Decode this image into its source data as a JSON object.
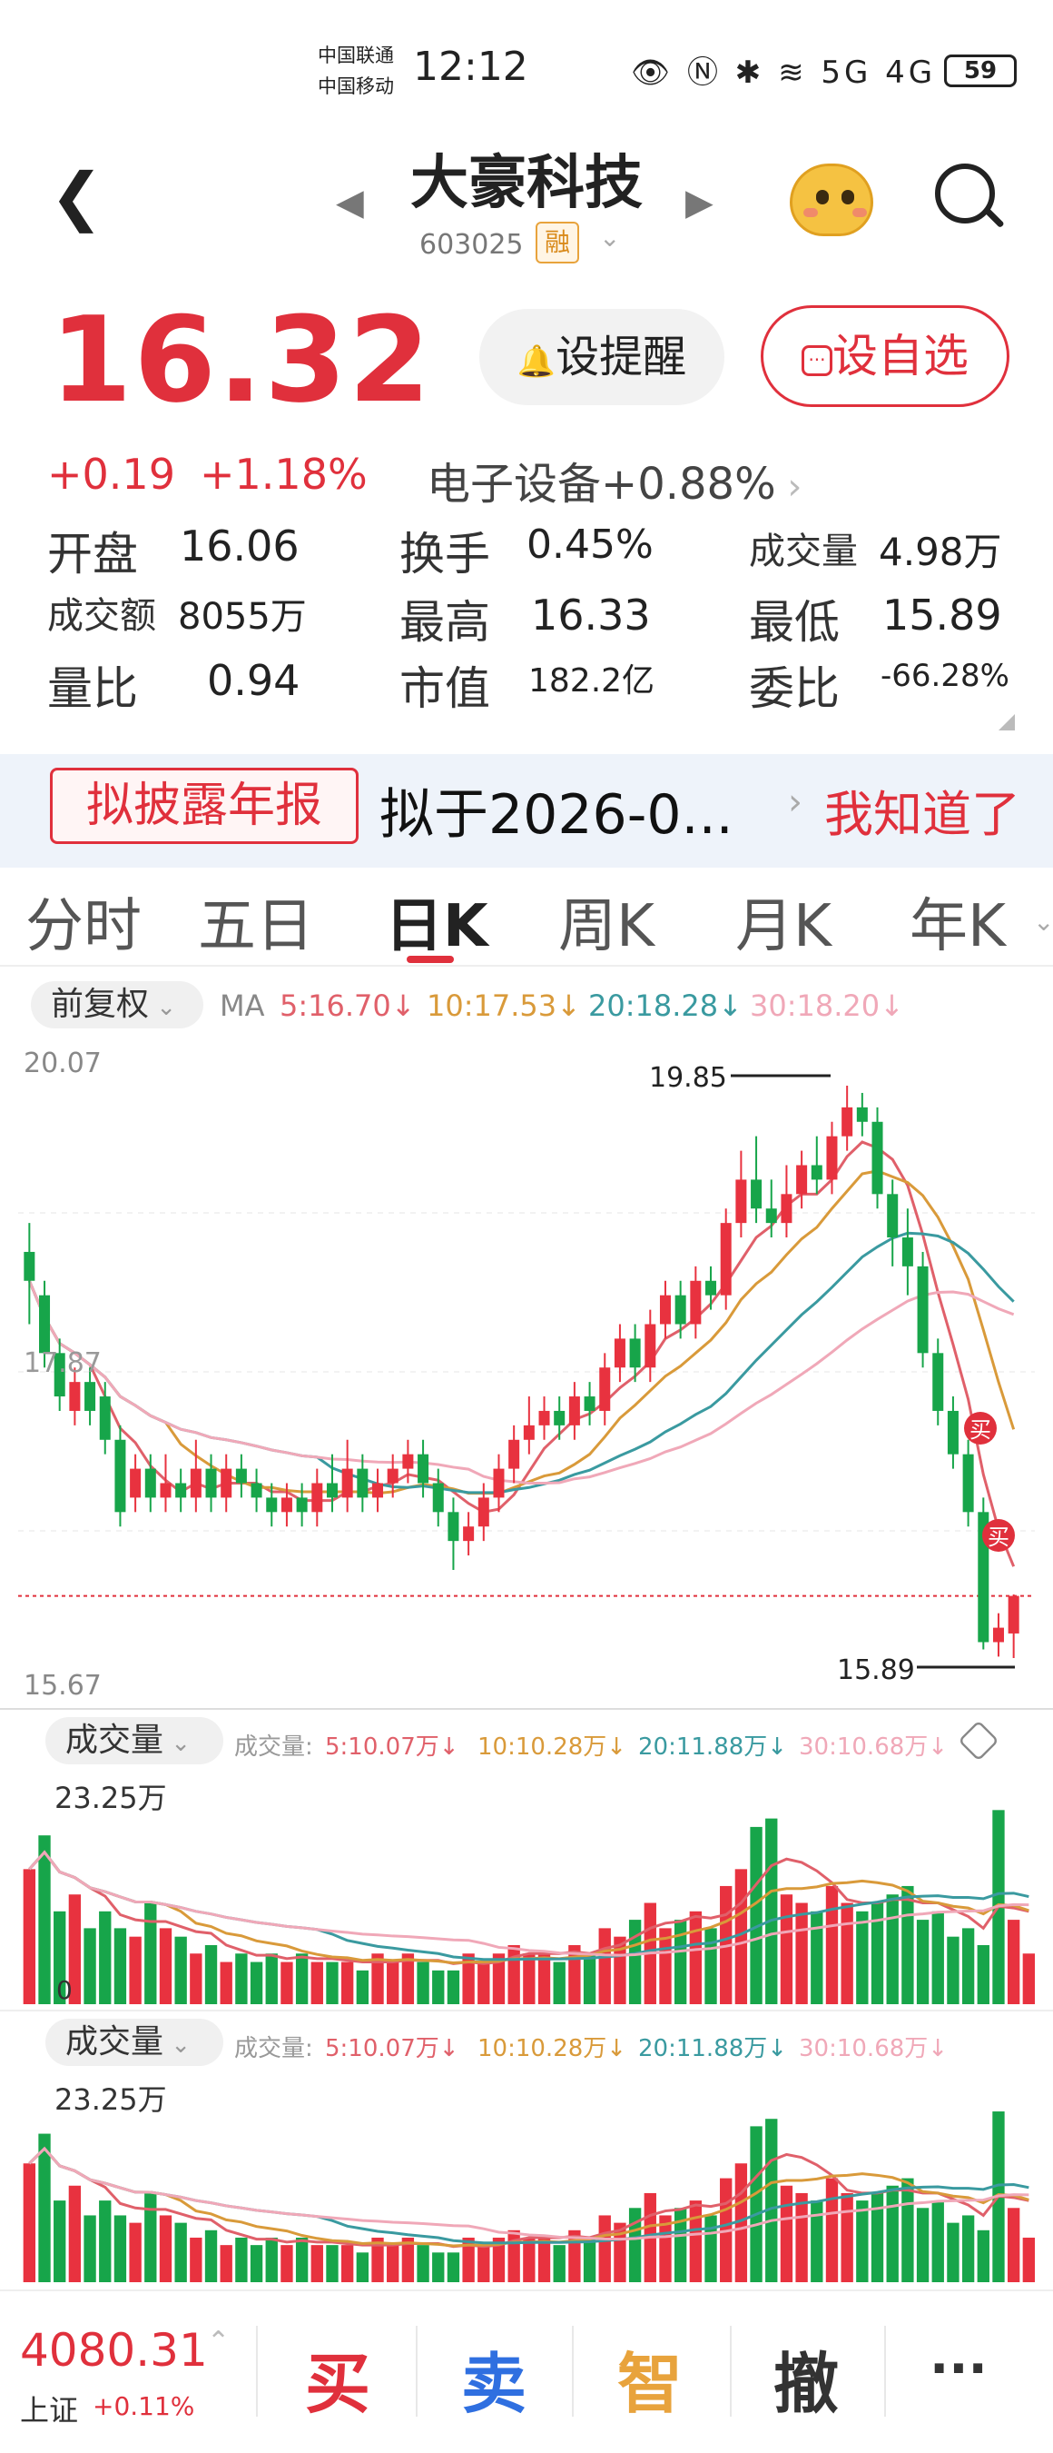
{
  "status_bar": {
    "carrier1": "中国联通",
    "carrier2": "中国移动",
    "time": "12:12",
    "icons": "👁 Ⓝ ✱ ≋ 5G 4G",
    "battery": "59"
  },
  "header": {
    "stock_name": "大豪科技",
    "stock_code": "603025",
    "margin_tag": "融"
  },
  "quote": {
    "price": "16.32",
    "change": "+0.19",
    "change_pct": "+1.18%",
    "sector": "电子设备+0.88%",
    "alert_button": "设提醒",
    "watchlist_button": "设自选",
    "rows": [
      [
        {
          "label": "开盘",
          "value": "16.06"
        },
        {
          "label": "换手",
          "value": "0.45%"
        },
        {
          "label": "成交量",
          "value": "4.98万"
        }
      ],
      [
        {
          "label": "成交额",
          "value": "8055万"
        },
        {
          "label": "最高",
          "value": "16.33"
        },
        {
          "label": "最低",
          "value": "15.89"
        }
      ],
      [
        {
          "label": "量比",
          "value": "0.94"
        },
        {
          "label": "市值",
          "value": "182.2亿"
        },
        {
          "label": "委比",
          "value": "-66.28%"
        }
      ]
    ]
  },
  "notice": {
    "tag": "拟披露年报",
    "text": "拟于2026-0...",
    "action": "我知道了"
  },
  "tabs": [
    "分时",
    "五日",
    "日K",
    "周K",
    "月K",
    "年K"
  ],
  "active_tab": "日K",
  "kline_controls": {
    "adjust": "前复权",
    "ma_label": "MA",
    "ma": [
      {
        "text": "5:16.70↓",
        "color": "#e0606a"
      },
      {
        "text": "10:17.53↓",
        "color": "#d99a3a"
      },
      {
        "text": "20:18.28↓",
        "color": "#3a9aa0"
      },
      {
        "text": "30:18.20↓",
        "color": "#f0a8b8"
      }
    ]
  },
  "chart_data": {
    "type": "candlestick",
    "y_max_label": "20.07",
    "y_min_label": "15.67",
    "mid_label": "17.87",
    "ylim": [
      15.67,
      20.07
    ],
    "high_marker": "19.85",
    "low_marker": "15.89",
    "buy_marker": "买",
    "candles": [
      [
        18.7,
        18.5,
        18.9,
        18.2
      ],
      [
        18.4,
        18.0,
        18.5,
        17.9
      ],
      [
        18.0,
        17.7,
        18.1,
        17.6
      ],
      [
        17.6,
        17.8,
        17.9,
        17.5
      ],
      [
        17.8,
        17.6,
        17.9,
        17.5
      ],
      [
        17.7,
        17.4,
        17.8,
        17.3
      ],
      [
        17.4,
        16.9,
        17.5,
        16.8
      ],
      [
        17.0,
        17.2,
        17.3,
        16.9
      ],
      [
        17.2,
        17.0,
        17.3,
        16.9
      ],
      [
        17.0,
        17.1,
        17.3,
        16.9
      ],
      [
        17.1,
        17.0,
        17.2,
        16.9
      ],
      [
        17.0,
        17.2,
        17.4,
        16.9
      ],
      [
        17.2,
        17.0,
        17.3,
        16.9
      ],
      [
        17.0,
        17.2,
        17.3,
        16.9
      ],
      [
        17.2,
        17.1,
        17.3,
        17.0
      ],
      [
        17.1,
        17.0,
        17.2,
        16.9
      ],
      [
        17.0,
        16.9,
        17.1,
        16.8
      ],
      [
        16.9,
        17.0,
        17.1,
        16.8
      ],
      [
        17.0,
        16.9,
        17.1,
        16.8
      ],
      [
        16.9,
        17.1,
        17.2,
        16.8
      ],
      [
        17.1,
        17.0,
        17.3,
        16.9
      ],
      [
        17.0,
        17.2,
        17.4,
        16.9
      ],
      [
        17.2,
        17.0,
        17.3,
        16.9
      ],
      [
        17.0,
        17.1,
        17.2,
        16.9
      ],
      [
        17.1,
        17.2,
        17.3,
        17.0
      ],
      [
        17.2,
        17.3,
        17.4,
        17.1
      ],
      [
        17.3,
        17.1,
        17.4,
        17.0
      ],
      [
        17.1,
        16.9,
        17.2,
        16.8
      ],
      [
        16.9,
        16.7,
        17.0,
        16.5
      ],
      [
        16.7,
        16.8,
        16.9,
        16.6
      ],
      [
        16.8,
        17.0,
        17.1,
        16.7
      ],
      [
        17.0,
        17.2,
        17.3,
        16.9
      ],
      [
        17.2,
        17.4,
        17.5,
        17.1
      ],
      [
        17.4,
        17.5,
        17.7,
        17.3
      ],
      [
        17.5,
        17.6,
        17.7,
        17.4
      ],
      [
        17.6,
        17.5,
        17.7,
        17.4
      ],
      [
        17.5,
        17.7,
        17.8,
        17.4
      ],
      [
        17.7,
        17.6,
        17.8,
        17.5
      ],
      [
        17.6,
        17.9,
        18.0,
        17.5
      ],
      [
        17.9,
        18.1,
        18.2,
        17.8
      ],
      [
        18.1,
        17.9,
        18.2,
        17.8
      ],
      [
        17.9,
        18.2,
        18.3,
        17.8
      ],
      [
        18.2,
        18.4,
        18.5,
        18.1
      ],
      [
        18.4,
        18.2,
        18.5,
        18.1
      ],
      [
        18.2,
        18.5,
        18.6,
        18.1
      ],
      [
        18.5,
        18.4,
        18.6,
        18.3
      ],
      [
        18.4,
        18.9,
        19.0,
        18.3
      ],
      [
        18.9,
        19.2,
        19.4,
        18.8
      ],
      [
        19.2,
        19.0,
        19.5,
        18.9
      ],
      [
        19.0,
        18.9,
        19.2,
        18.8
      ],
      [
        18.9,
        19.1,
        19.3,
        18.8
      ],
      [
        19.1,
        19.3,
        19.4,
        19.0
      ],
      [
        19.3,
        19.2,
        19.5,
        19.1
      ],
      [
        19.2,
        19.5,
        19.6,
        19.1
      ],
      [
        19.5,
        19.7,
        19.85,
        19.4
      ],
      [
        19.7,
        19.6,
        19.8,
        19.5
      ],
      [
        19.6,
        19.1,
        19.7,
        19.0
      ],
      [
        19.1,
        18.8,
        19.2,
        18.6
      ],
      [
        18.8,
        18.6,
        19.0,
        18.4
      ],
      [
        18.6,
        18.0,
        18.7,
        17.9
      ],
      [
        18.0,
        17.6,
        18.1,
        17.5
      ],
      [
        17.6,
        17.3,
        17.7,
        17.2
      ],
      [
        17.3,
        16.9,
        17.4,
        16.8
      ],
      [
        16.9,
        16.0,
        17.0,
        15.95
      ],
      [
        16.0,
        16.1,
        16.2,
        15.9
      ],
      [
        16.06,
        16.32,
        16.33,
        15.89
      ]
    ],
    "volume_max_label": "23.25万",
    "volume_zero_label": "0",
    "volume_label": "成交量",
    "volume_ma": [
      {
        "text": "5:10.07万↓",
        "color": "#e0606a"
      },
      {
        "text": "10:10.28万↓",
        "color": "#d99a3a"
      },
      {
        "text": "20:11.88万↓",
        "color": "#3a9aa0"
      },
      {
        "text": "30:10.68万↓",
        "color": "#f0a8b8"
      }
    ],
    "volume_prefix": "成交量:",
    "volumes": [
      16,
      20,
      11,
      13,
      9,
      11,
      9,
      8,
      12,
      9,
      8,
      6,
      7,
      5,
      6,
      5,
      6,
      5,
      6,
      5,
      5,
      5,
      4,
      6,
      5,
      6,
      5,
      4,
      4,
      6,
      5,
      6,
      7,
      6,
      6,
      5,
      7,
      6,
      9,
      8,
      10,
      12,
      9,
      10,
      11,
      9,
      14,
      16,
      21,
      22,
      13,
      12,
      11,
      14,
      12,
      11,
      12,
      13,
      14,
      10,
      11,
      8,
      9,
      7,
      23,
      10,
      6
    ],
    "volume_up": [
      1,
      0,
      0,
      1,
      0,
      0,
      0,
      1,
      0,
      1,
      0,
      1,
      0,
      1,
      0,
      0,
      0,
      1,
      0,
      1,
      0,
      1,
      0,
      1,
      1,
      1,
      0,
      0,
      0,
      1,
      1,
      1,
      1,
      1,
      1,
      0,
      1,
      0,
      1,
      1,
      0,
      1,
      1,
      0,
      1,
      0,
      1,
      1,
      0,
      0,
      1,
      1,
      0,
      1,
      1,
      0,
      0,
      0,
      0,
      0,
      0,
      0,
      0,
      0,
      0,
      1,
      1
    ]
  },
  "bottom_bar": {
    "index_value": "4080.31",
    "index_name": "上证",
    "index_change": "+0.11%",
    "buy": "买",
    "sell": "卖",
    "smart": "智",
    "cancel": "撤",
    "more": "···"
  }
}
